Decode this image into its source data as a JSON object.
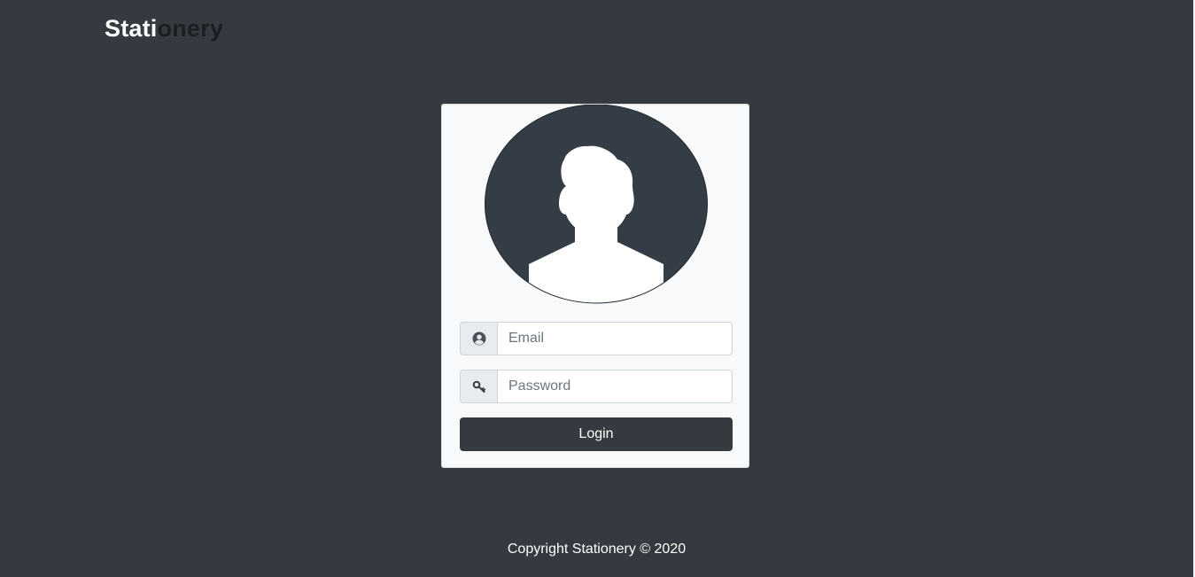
{
  "brand": {
    "part_a": "Stati",
    "part_b": "onery",
    "colors": {
      "part_a": "#ffffff",
      "part_b": "#1b1e21"
    }
  },
  "login": {
    "avatar_icon": "user-silhouette-icon",
    "email": {
      "icon": "user-circle-icon",
      "placeholder": "Email",
      "value": ""
    },
    "password": {
      "icon": "key-icon",
      "placeholder": "Password",
      "value": ""
    },
    "submit_label": "Login"
  },
  "footer": {
    "text": "Copyright Stationery © 2020"
  },
  "colors": {
    "background": "#343a40",
    "card": "#f8f9fa",
    "button": "#343a40",
    "avatar_circle": "#343d46"
  }
}
